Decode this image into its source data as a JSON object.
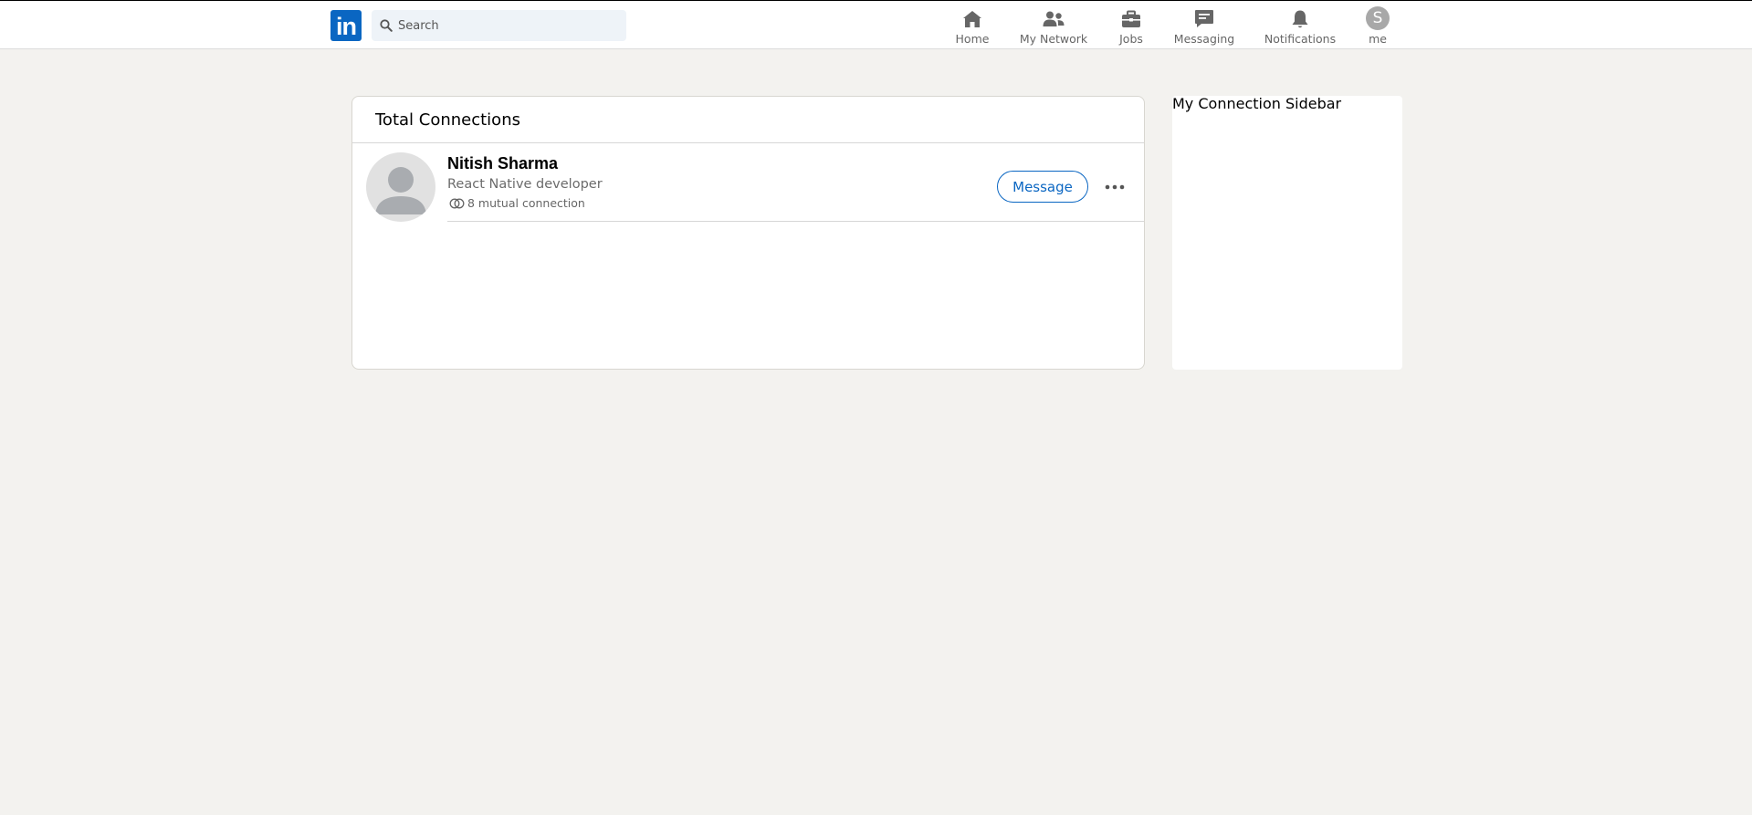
{
  "colors": {
    "background": "#f3f2ef",
    "brand": "#0a66c2",
    "nav_icon": "#666666"
  },
  "header": {
    "logo_text": "in",
    "search": {
      "placeholder": "Search",
      "value": ""
    },
    "nav": [
      {
        "label": "Home",
        "icon": "home-icon"
      },
      {
        "label": "My Network",
        "icon": "network-icon"
      },
      {
        "label": "Jobs",
        "icon": "briefcase-icon"
      },
      {
        "label": "Messaging",
        "icon": "messaging-icon"
      },
      {
        "label": "Notifications",
        "icon": "bell-icon"
      },
      {
        "label": "me",
        "icon": "avatar",
        "avatar_initial": "S"
      }
    ]
  },
  "connections": {
    "title": "Total Connections",
    "items": [
      {
        "name": "Nitish Sharma",
        "headline": "React Native developer",
        "mutual": "8 mutual connection",
        "message_label": "Message"
      }
    ]
  },
  "sidebar": {
    "title": "My Connection Sidebar"
  }
}
